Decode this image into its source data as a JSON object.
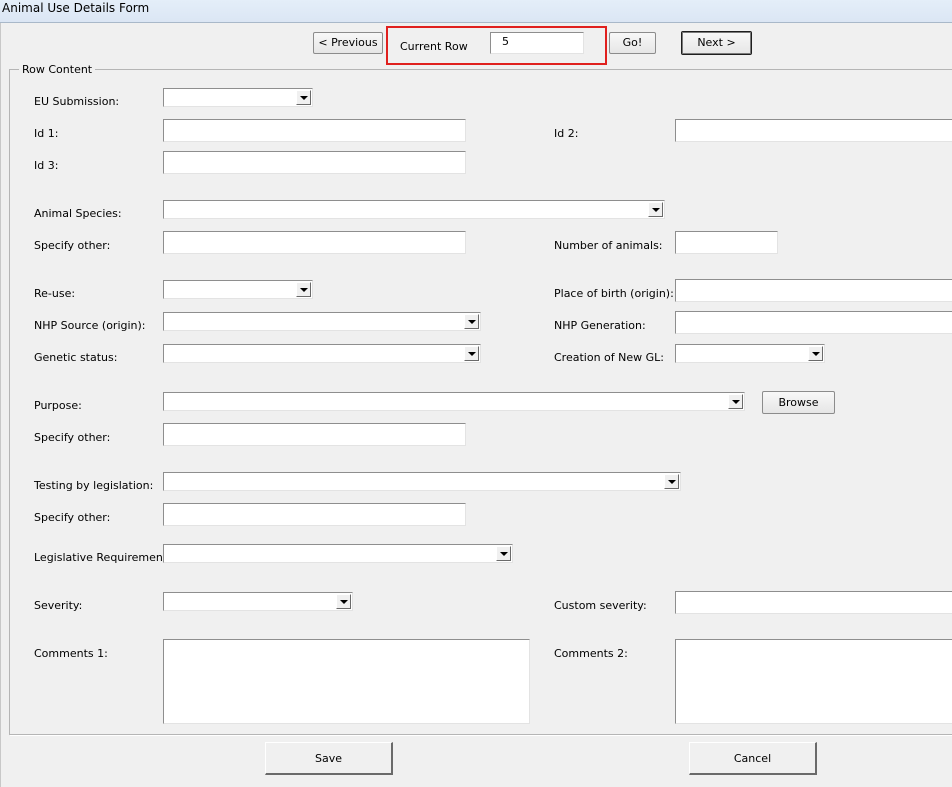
{
  "window": {
    "title": "Animal Use Details Form"
  },
  "nav": {
    "previous_label": "< Previous",
    "current_row_label": "Current Row",
    "current_row_value": "5",
    "go_label": "Go!",
    "next_label": "Next >",
    "highlight_color": "#e0201e"
  },
  "section": {
    "legend": "Row Content"
  },
  "fields": {
    "eu_submission": {
      "label": "EU Submission:",
      "value": ""
    },
    "id1": {
      "label": "Id 1:",
      "value": ""
    },
    "id2": {
      "label": "Id 2:",
      "value": ""
    },
    "id3": {
      "label": "Id 3:",
      "value": ""
    },
    "animal_species": {
      "label": "Animal Species:",
      "value": ""
    },
    "species_other": {
      "label": "Specify other:",
      "value": ""
    },
    "number_of_animals": {
      "label": "Number of animals:",
      "value": ""
    },
    "reuse": {
      "label": "Re-use:",
      "value": ""
    },
    "place_of_birth": {
      "label": "Place of birth (origin):",
      "value": ""
    },
    "nhp_source": {
      "label": "NHP Source (origin):",
      "value": ""
    },
    "nhp_generation": {
      "label": "NHP Generation:",
      "value": ""
    },
    "genetic_status": {
      "label": "Genetic status:",
      "value": ""
    },
    "creation_new_gl": {
      "label": "Creation of New GL:",
      "value": ""
    },
    "purpose": {
      "label": "Purpose:",
      "value": "",
      "browse_label": "Browse"
    },
    "purpose_other": {
      "label": "Specify other:",
      "value": ""
    },
    "testing_by_legislation": {
      "label": "Testing by legislation:",
      "value": ""
    },
    "testing_other": {
      "label": "Specify other:",
      "value": ""
    },
    "legislative_requirements": {
      "label": "Legislative Requirements:",
      "value": ""
    },
    "severity": {
      "label": "Severity:",
      "value": ""
    },
    "custom_severity": {
      "label": "Custom severity:",
      "value": ""
    },
    "comments1": {
      "label": "Comments 1:",
      "value": ""
    },
    "comments2": {
      "label": "Comments 2:",
      "value": ""
    }
  },
  "footer": {
    "save_label": "Save",
    "cancel_label": "Cancel"
  }
}
